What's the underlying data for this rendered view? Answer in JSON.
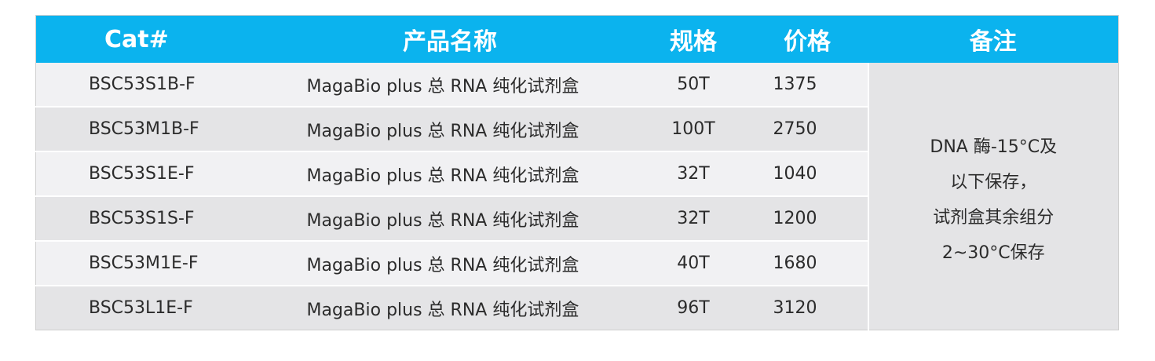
{
  "table": {
    "headers": {
      "cat": "Cat#",
      "name": "产品名称",
      "spec": "规格",
      "price": "价格",
      "note": "备注"
    },
    "rows": [
      {
        "cat": "BSC53S1B-F",
        "name": "MagaBio plus 总 RNA 纯化试剂盒",
        "spec": "50T",
        "price": "1375"
      },
      {
        "cat": "BSC53M1B-F",
        "name": "MagaBio plus 总 RNA 纯化试剂盒",
        "spec": "100T",
        "price": "2750"
      },
      {
        "cat": "BSC53S1E-F",
        "name": "MagaBio plus 总 RNA 纯化试剂盒",
        "spec": "32T",
        "price": "1040"
      },
      {
        "cat": "BSC53S1S-F",
        "name": "MagaBio plus 总 RNA 纯化试剂盒",
        "spec": "32T",
        "price": "1200"
      },
      {
        "cat": "BSC53M1E-F",
        "name": "MagaBio plus 总 RNA 纯化试剂盒",
        "spec": "40T",
        "price": "1680"
      },
      {
        "cat": "BSC53L1E-F",
        "name": "MagaBio plus 总 RNA 纯化试剂盒",
        "spec": "96T",
        "price": "3120"
      }
    ],
    "note_lines": [
      "DNA 酶-15°C及",
      "以下保存，",
      "试剂盒其余组分",
      "2~30°C保存"
    ]
  },
  "colors": {
    "header_bg": "#0bb3ee",
    "header_text": "#ffffff",
    "row_light": "#f1f1f3",
    "row_dark": "#e4e4e6",
    "body_text": "#2b2b2b"
  }
}
